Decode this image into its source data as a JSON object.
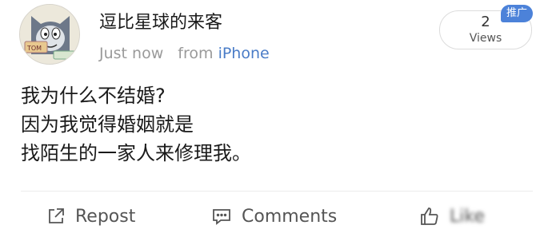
{
  "author": {
    "name": "逗比星球的来客",
    "avatar_icon": "tom-cat-avatar"
  },
  "meta": {
    "time": "Just now",
    "source_prefix": "from",
    "source": "iPhone"
  },
  "views": {
    "count": "2",
    "label": "Views"
  },
  "promo_badge": "推广",
  "content": {
    "lines": [
      "我为什么不结婚?",
      "因为我觉得婚姻就是",
      "找陌生的一家人来修理我。"
    ]
  },
  "actions": {
    "repost": {
      "label": "Repost",
      "icon": "repost-icon"
    },
    "comments": {
      "label": "Comments",
      "icon": "comment-icon"
    },
    "like": {
      "label": "Like",
      "icon": "thumbs-up-icon"
    }
  },
  "colors": {
    "link": "#4a7cc7",
    "badge": "#4c82d9",
    "meta": "#9a9a9a"
  }
}
